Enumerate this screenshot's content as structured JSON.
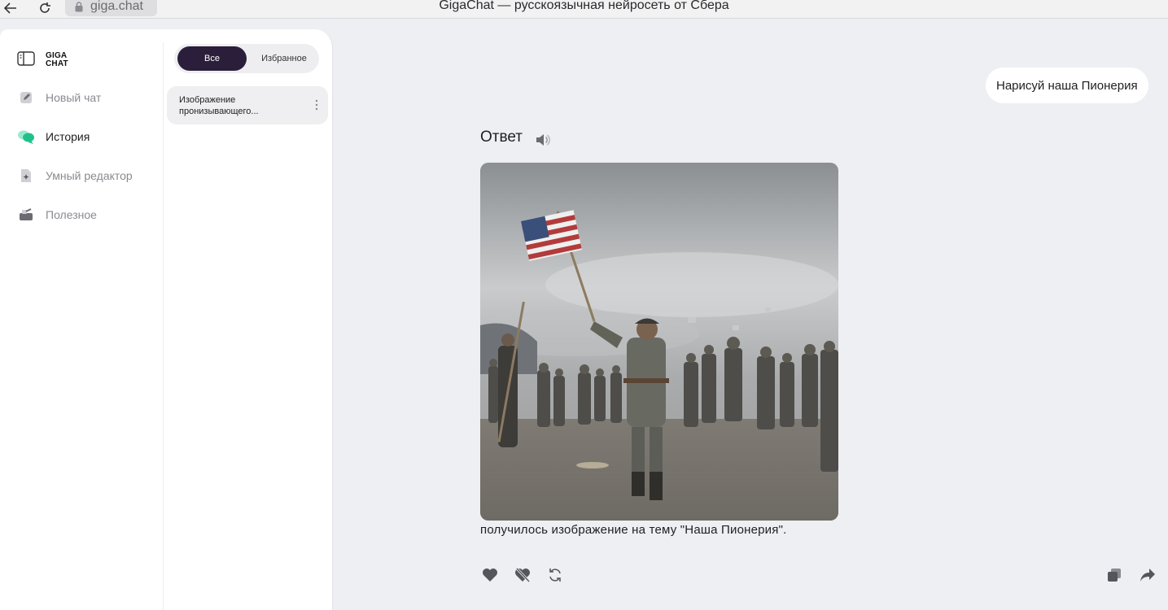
{
  "browser": {
    "url": "giga.chat",
    "title": "GigaChat — русскоязычная нейросеть от Сбера"
  },
  "sidebar": {
    "logo_text": "GIGA CHAT",
    "items": [
      {
        "label": "Новый чат",
        "icon": "pencil-icon"
      },
      {
        "label": "История",
        "icon": "chat-bubbles-icon",
        "active": true
      },
      {
        "label": "Умный редактор",
        "icon": "document-sparkle-icon"
      },
      {
        "label": "Полезное",
        "icon": "toolbox-icon"
      }
    ]
  },
  "history": {
    "tabs": [
      {
        "label": "Все",
        "selected": true
      },
      {
        "label": "Избранное",
        "selected": false
      }
    ],
    "items": [
      {
        "title": "Изображение пронизывающего..."
      }
    ]
  },
  "chat": {
    "user_message": "Нарисуй наша Пионерия",
    "answer_heading": "Ответ",
    "answer_text": "получилось изображение на тему \"Наша Пионерия\".",
    "image_icon": "generated-photo",
    "actions": [
      "like-icon",
      "dislike-icon",
      "regenerate-icon",
      "copy-icon",
      "share-icon"
    ]
  },
  "colors": {
    "accent_dark": "#2b1e3b",
    "history_icon": "#21c08b",
    "background": "#eeeff2"
  }
}
